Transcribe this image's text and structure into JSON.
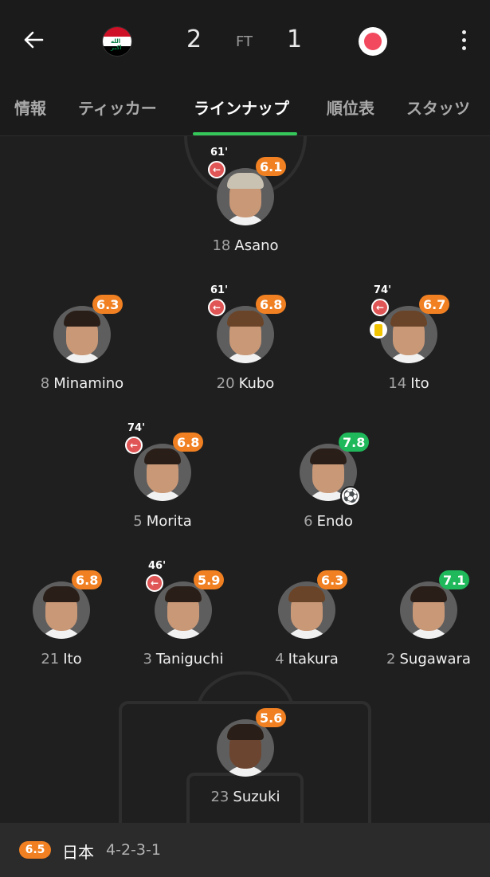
{
  "header": {
    "home_score": "2",
    "status": "FT",
    "away_score": "1",
    "home_team_flag": "iraq-flag",
    "away_team_flag": "japan-flag"
  },
  "tabs": [
    {
      "label": "情報",
      "active": false
    },
    {
      "label": "ティッカー",
      "active": false
    },
    {
      "label": "ラインナップ",
      "active": true
    },
    {
      "label": "順位表",
      "active": false
    },
    {
      "label": "スタッツ",
      "active": false
    }
  ],
  "players": [
    {
      "number": "18",
      "name": "Asano",
      "rating": "6.1",
      "sub_minute": "61'",
      "subbed": true
    },
    {
      "number": "8",
      "name": "Minamino",
      "rating": "6.3"
    },
    {
      "number": "20",
      "name": "Kubo",
      "rating": "6.8",
      "sub_minute": "61'",
      "subbed": true
    },
    {
      "number": "14",
      "name": "Ito",
      "rating": "6.7",
      "sub_minute": "74'",
      "subbed": true,
      "yellow_card": true
    },
    {
      "number": "5",
      "name": "Morita",
      "rating": "6.8",
      "sub_minute": "74'",
      "subbed": true
    },
    {
      "number": "6",
      "name": "Endo",
      "rating": "7.8",
      "goal": true
    },
    {
      "number": "21",
      "name": "Ito",
      "rating": "6.8"
    },
    {
      "number": "3",
      "name": "Taniguchi",
      "rating": "5.9",
      "sub_minute": "46'",
      "subbed": true
    },
    {
      "number": "4",
      "name": "Itakura",
      "rating": "6.3"
    },
    {
      "number": "2",
      "name": "Sugawara",
      "rating": "7.1"
    },
    {
      "number": "23",
      "name": "Suzuki",
      "rating": "5.6"
    }
  ],
  "footer": {
    "team_rating": "6.5",
    "team_name": "日本",
    "formation": "4-2-3-1"
  },
  "colors": {
    "rating_orange": "#f08022",
    "rating_green": "#1fb85a",
    "tab_indicator": "#35c759",
    "sub_icon": "#e05555",
    "yellow_card": "#f2c400"
  }
}
